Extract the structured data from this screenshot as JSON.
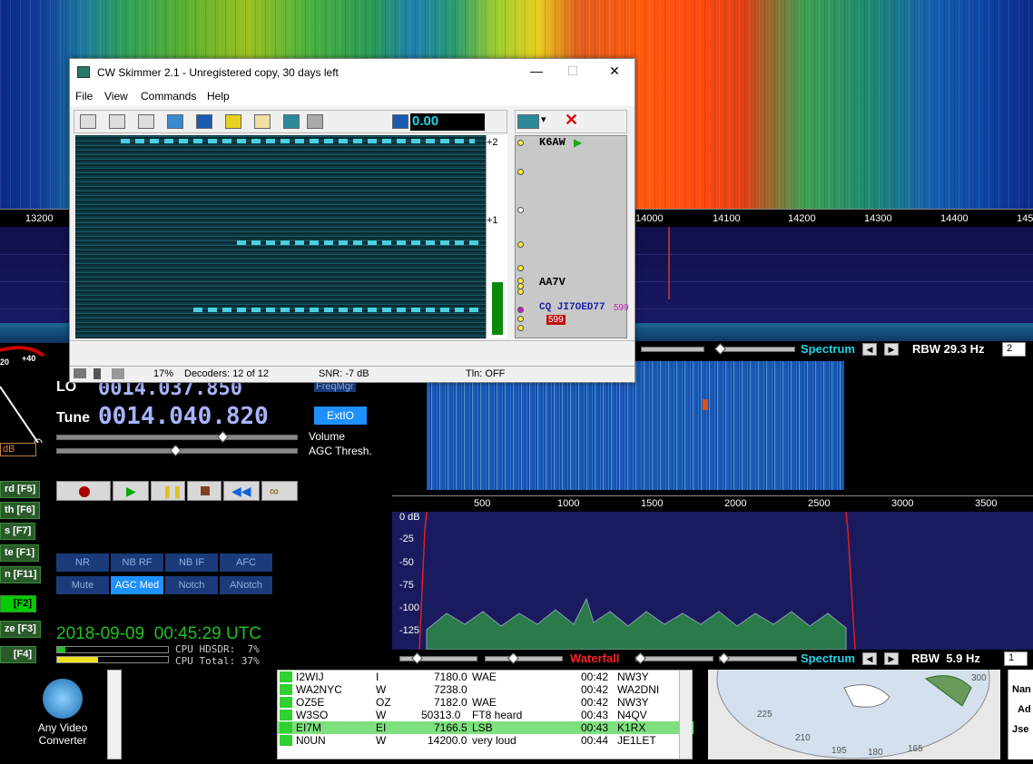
{
  "top_scale": {
    "ticks": [
      "13200",
      "14000",
      "14100",
      "14200",
      "14300",
      "14400",
      "145"
    ]
  },
  "top_bar": {
    "spectrum_label": "Spectrum",
    "rbw_label": "RBW 29.3 Hz",
    "rbw_num": "2"
  },
  "cw_window": {
    "title": "CW Skimmer 2.1 - Unregistered copy, 30 days left",
    "menu": [
      "File",
      "View",
      "Commands",
      "Help"
    ],
    "readout": "0.00",
    "scale": [
      "+2",
      "+1"
    ],
    "callsigns": [
      {
        "text": "K6AW",
        "color": "#006400"
      },
      {
        "text": "AA7V",
        "color": "#006400"
      },
      {
        "text": "CQ JI7OED77",
        "color": "#1a1aaa"
      }
    ],
    "tag_599_a": "599",
    "tag_599_b": "599",
    "status": {
      "percent": "17%",
      "decoders": "Decoders: 12 of 12",
      "snr": "SNR: -7 dB",
      "tln": "Tln: OFF"
    }
  },
  "left_panel": {
    "gauge_labels": [
      "20",
      "+40"
    ],
    "squelch": "unus\nuelch",
    "db": "dB",
    "lo_label": "LO",
    "lo_a": "A",
    "lo_value": "0014.037.850",
    "tune_label": "Tune",
    "tune_value": "0014.040.820",
    "freqmgr": "FreqMgr",
    "extio": "ExtIO",
    "volume": "Volume",
    "agc_thresh": "AGC Thresh.",
    "fkeys": [
      "rd [F5]",
      "th [F6]",
      "s [F7]",
      "te [F1]",
      "n [F11]",
      "[F2]",
      "ze [F3]",
      "[F4]"
    ],
    "buttons_row1": [
      "NR",
      "NB RF",
      "NB IF",
      "AFC"
    ],
    "buttons_row2": [
      "Mute",
      "AGC Med",
      "Notch",
      "ANotch"
    ],
    "datetime": "2018-09-09  00:45:29 UTC",
    "cpu_hdsdr": "CPU HDSDR:  7%",
    "cpu_total": "CPU Total: 37%"
  },
  "mid_scale": {
    "ticks": [
      "500",
      "1000",
      "1500",
      "2000",
      "2500",
      "3000",
      "3500"
    ]
  },
  "mid_spec": {
    "db_labels": [
      "0 dB",
      "-25",
      "-50",
      "-75",
      "-100",
      "-125"
    ]
  },
  "bottom_bar": {
    "waterfall_label": "Waterfall",
    "spectrum_label": "Spectrum",
    "rbw_label": "RBW  5.9 Hz",
    "rbw_num": "1"
  },
  "table": {
    "rows": [
      {
        "call": "I2WIJ",
        "pfx": "I",
        "freq": "7180.0",
        "info": "WAE",
        "time": "00:42",
        "spotter": "NW3Y",
        "hl": false
      },
      {
        "call": "WA2NYC",
        "pfx": "W",
        "freq": "7238.0",
        "info": "",
        "time": "00:42",
        "spotter": "WA2DNI",
        "hl": false
      },
      {
        "call": "OZ5E",
        "pfx": "OZ",
        "freq": "7182.0",
        "info": "WAE",
        "time": "00:42",
        "spotter": "NW3Y",
        "hl": false
      },
      {
        "call": "W3SO",
        "pfx": "W",
        "freq": "50313.0",
        "info": "FT8 heard",
        "time": "00:43",
        "spotter": "N4QV",
        "hl": false
      },
      {
        "call": "EI7M",
        "pfx": "EI",
        "freq": "7166.5",
        "info": "LSB",
        "time": "00:43",
        "spotter": "K1RX",
        "hl": true
      },
      {
        "call": "N0UN",
        "pfx": "W",
        "freq": "14200.0",
        "info": "very loud",
        "time": "00:44",
        "spotter": "JE1LET",
        "hl": false
      }
    ]
  },
  "desktop_icon": {
    "label": "Any Video Converter"
  },
  "right_edge": [
    "Nan",
    "Ad",
    "Jse"
  ],
  "map_labels": [
    "225",
    "210",
    "195",
    "180",
    "165",
    "300"
  ],
  "colors": {
    "accent_cyan": "#22d3e6",
    "waterfall_label": "#ff2020",
    "spectrum_label": "#22d3e6"
  }
}
